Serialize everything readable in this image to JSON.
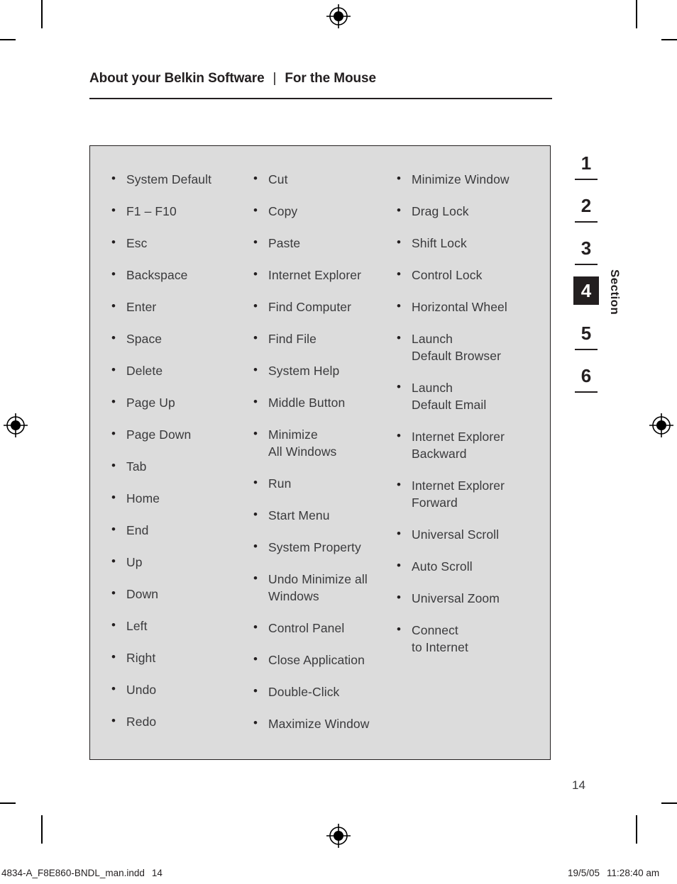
{
  "header": {
    "title_left": "About your Belkin Software",
    "separator": "|",
    "title_right": "For the Mouse"
  },
  "panel": {
    "columns": [
      {
        "name": "keyboard-commands",
        "items": [
          {
            "line1": "System Default"
          },
          {
            "line1": "F1 – F10"
          },
          {
            "line1": "Esc"
          },
          {
            "line1": "Backspace"
          },
          {
            "line1": "Enter"
          },
          {
            "line1": "Space"
          },
          {
            "line1": "Delete"
          },
          {
            "line1": "Page Up"
          },
          {
            "line1": "Page Down"
          },
          {
            "line1": "Tab"
          },
          {
            "line1": "Home"
          },
          {
            "line1": "End"
          },
          {
            "line1": "Up"
          },
          {
            "line1": "Down"
          },
          {
            "line1": "Left"
          },
          {
            "line1": "Right"
          },
          {
            "line1": "Undo"
          },
          {
            "line1": "Redo"
          }
        ]
      },
      {
        "name": "system-commands",
        "items": [
          {
            "line1": "Cut"
          },
          {
            "line1": "Copy"
          },
          {
            "line1": "Paste"
          },
          {
            "line1": "Internet Explorer"
          },
          {
            "line1": "Find Computer"
          },
          {
            "line1": "Find File"
          },
          {
            "line1": "System Help"
          },
          {
            "line1": "Middle Button"
          },
          {
            "line1": "Minimize",
            "line2": "All Windows"
          },
          {
            "line1": "Run"
          },
          {
            "line1": "Start Menu"
          },
          {
            "line1": "System Property"
          },
          {
            "line1": "Undo Minimize all",
            "line2": "Windows"
          },
          {
            "line1": "Control Panel"
          },
          {
            "line1": "Close Application"
          },
          {
            "line1": "Double-Click"
          },
          {
            "line1": "Maximize Window"
          }
        ]
      },
      {
        "name": "mouse-commands",
        "items": [
          {
            "line1": "Minimize Window"
          },
          {
            "line1": "Drag Lock"
          },
          {
            "line1": "Shift Lock"
          },
          {
            "line1": "Control Lock"
          },
          {
            "line1": "Horizontal Wheel"
          },
          {
            "line1": "Launch",
            "line2": "Default Browser"
          },
          {
            "line1": "Launch",
            "line2": "Default Email"
          },
          {
            "line1": "Internet Explorer",
            "line2": "Backward"
          },
          {
            "line1": "Internet Explorer",
            "line2": "Forward"
          },
          {
            "line1": "Universal Scroll"
          },
          {
            "line1": "Auto Scroll"
          },
          {
            "line1": "Universal Zoom"
          },
          {
            "line1": "Connect",
            "line2": "to Internet"
          }
        ]
      }
    ]
  },
  "section_nav": {
    "label": "Section",
    "items": [
      {
        "number": "1",
        "active": false
      },
      {
        "number": "2",
        "active": false
      },
      {
        "number": "3",
        "active": false
      },
      {
        "number": "4",
        "active": true
      },
      {
        "number": "5",
        "active": false
      },
      {
        "number": "6",
        "active": false
      }
    ]
  },
  "page_number": "14",
  "print_footer": {
    "filename": "4834-A_F8E860-BNDL_man.indd",
    "page": "14",
    "date": "19/5/05",
    "time": "11:28:40 am"
  },
  "colors": {
    "panel_background": "#dcdcdc",
    "ink": "#231f20",
    "body_text": "#3a3a3c",
    "page_background": "#ffffff"
  }
}
